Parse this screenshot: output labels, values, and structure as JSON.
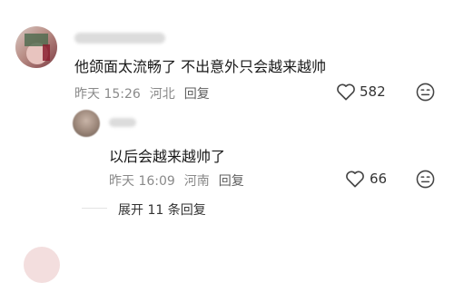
{
  "comments": [
    {
      "text": "他颌面太流畅了 不出意外只会越来越帅",
      "time": "昨天 15:26",
      "location": "河北",
      "reply_label": "回复",
      "likes": "582"
    },
    {
      "text": "以后会越来越帅了",
      "time": "昨天 16:09",
      "location": "河南",
      "reply_label": "回复",
      "likes": "66"
    }
  ],
  "expand_label": "展开 11 条回复",
  "icons": {
    "like": "heart-outline-icon",
    "dislike": "meh-face-icon"
  },
  "colors": {
    "text": "#1a1a1a",
    "meta": "#8a8a8a",
    "icon": "#444444"
  }
}
